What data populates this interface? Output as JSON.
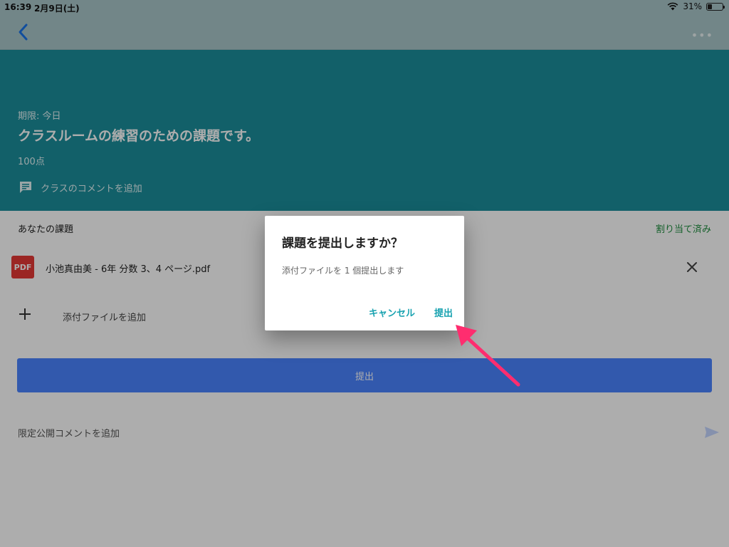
{
  "status_bar": {
    "time": "16:39",
    "date": "2月9日(土)",
    "battery": "31%",
    "battery_level": 0.31
  },
  "header": {
    "due": "期限: 今日",
    "title": "クラスルームの練習のための課題です。",
    "points": "100点",
    "class_comment": "クラスのコメントを追加"
  },
  "work": {
    "label": "あなたの課題",
    "status": "割り当て済み",
    "file": {
      "type": "PDF",
      "name": "小池真由美 - 6年 分数 3、4 ページ.pdf"
    },
    "add_attachment": "添付ファイルを追加",
    "submit": "提出",
    "private_comment": "限定公開コメントを追加"
  },
  "dialog": {
    "title": "課題を提出しますか？",
    "message": "添付ファイルを 1 個提出します",
    "cancel": "キャンセル",
    "submit": "提出"
  },
  "colors": {
    "header": "#1b8e9b",
    "primary_button": "#4a83ff",
    "assigned": "#1e8e3e",
    "dialog_action": "#18a2b0",
    "annotation": "#ff2d6f"
  }
}
